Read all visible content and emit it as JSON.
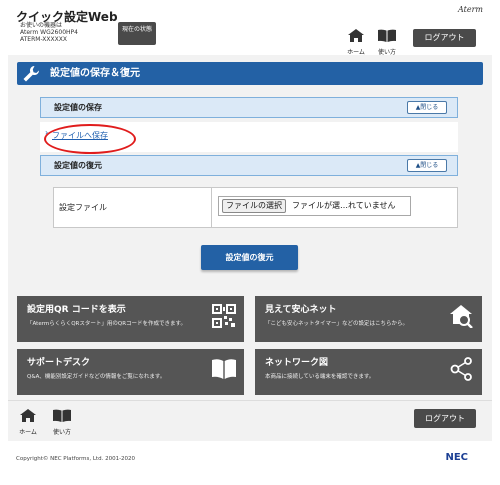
{
  "header": {
    "app_title": "クイック設定Web",
    "device_label": "お使いの機器は",
    "model": "Aterm WG2600HP4",
    "serial": "ATERM-XXXXXX",
    "state_button": "現在の状態",
    "home_label": "ホーム",
    "guide_label": "使い方",
    "logout_label": "ログアウト",
    "brand": "Aterm"
  },
  "page": {
    "title": "設定値の保存＆復元"
  },
  "save_section": {
    "title": "設定値の保存",
    "close_label": "▲閉じる",
    "link_label": "ファイルへ保存",
    "bullet": "›"
  },
  "restore_section": {
    "title": "設定値の復元",
    "close_label": "▲閉じる",
    "file_label": "設定ファイル",
    "choose_button": "ファイルの選択",
    "file_status": "ファイルが選…れていません",
    "restore_button": "設定値の復元"
  },
  "tiles": [
    {
      "title": "設定用QR コードを表示",
      "desc": "「AtermらくらくQRスタート」用のQRコードを作成できます。",
      "icon": "qr-code-icon"
    },
    {
      "title": "見えて安心ネット",
      "desc": "「こども安心ネットタイマー」などの設定はこちらから。",
      "icon": "home-search-icon"
    },
    {
      "title": "サポートデスク",
      "desc": "Q&A、機能別設定ガイドなどの情報をご覧になれます。",
      "icon": "book-icon"
    },
    {
      "title": "ネットワーク図",
      "desc": "本商品に接続している端末を確認できます。",
      "icon": "network-icon"
    }
  ],
  "footer": {
    "home_label": "ホーム",
    "guide_label": "使い方",
    "logout_label": "ログアウト",
    "copyright": "Copyright© NEC Platforms, Ltd. 2001-2020",
    "brand": "NEC"
  },
  "colors": {
    "primary": "#2361a5",
    "tile": "#555555",
    "highlight": "#e01c1c"
  }
}
